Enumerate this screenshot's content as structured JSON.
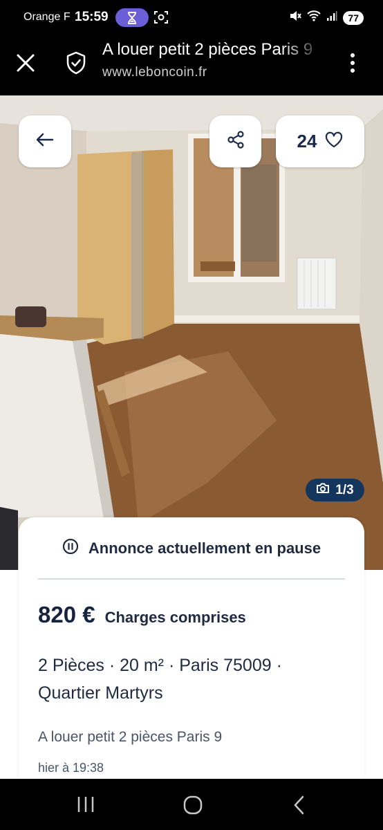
{
  "status_bar": {
    "carrier": "Orange F",
    "time": "15:59",
    "battery": "77",
    "icons": [
      "hourglass-icon",
      "screenshot-icon",
      "mute-icon",
      "wifi-icon",
      "signal-icon"
    ]
  },
  "browser": {
    "title": "A louer petit 2 pièces Paris 9",
    "url": "www.leboncoin.fr",
    "icons": [
      "close-icon",
      "shield-check-icon",
      "more-vert-icon"
    ]
  },
  "gallery": {
    "favorites_count": "24",
    "photo_counter": "1/3",
    "icons": [
      "arrow-left-icon",
      "share-icon",
      "heart-icon",
      "camera-icon"
    ]
  },
  "listing": {
    "status": "Annonce actuellement en pause",
    "price": "820 €",
    "price_note": "Charges comprises",
    "details_line1": "2 Pièces · 20 m² · Paris 75009 ·",
    "details_line2": "Quartier Martyrs",
    "title": "A louer petit 2 pièces Paris 9",
    "date": "hier à 19:38"
  },
  "colors": {
    "accent_dark": "#14365c",
    "text_dark": "#1f2a40",
    "timer_pill": "#6b5fd8"
  }
}
